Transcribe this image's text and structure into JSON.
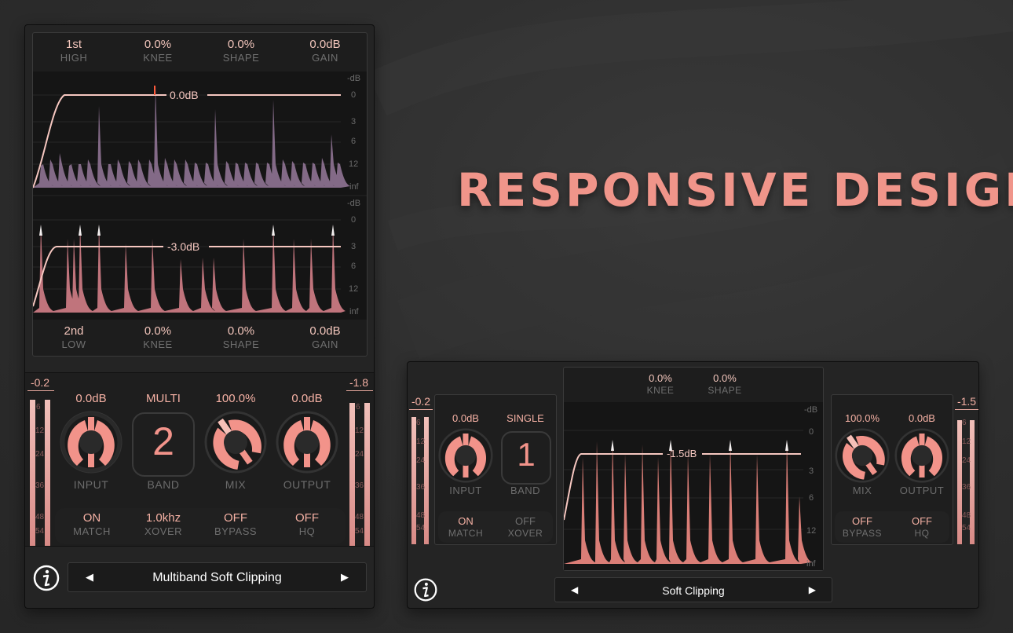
{
  "headline": "RESPONSIVE DESIGN",
  "colors": {
    "accent": "#f0958a",
    "knob": "#f2938a",
    "panel": "#242424",
    "wave_upper": "#8f7394",
    "wave_lower": "#c97982"
  },
  "icons": {
    "info": "info-icon",
    "prev": "left-arrow-icon",
    "next": "right-arrow-icon"
  },
  "large": {
    "top_params": [
      {
        "value": "1st",
        "label": "HIGH"
      },
      {
        "value": "0.0%",
        "label": "KNEE"
      },
      {
        "value": "0.0%",
        "label": "SHAPE"
      },
      {
        "value": "0.0dB",
        "label": "GAIN"
      }
    ],
    "upper_graph": {
      "threshold": "0.0dB",
      "scale": [
        "-dB",
        "0",
        "3",
        "6",
        "12",
        "inf"
      ]
    },
    "lower_graph": {
      "threshold": "-3.0dB",
      "scale": [
        "-dB",
        "0",
        "3",
        "6",
        "12",
        "inf"
      ]
    },
    "bottom_params": [
      {
        "value": "2nd",
        "label": "LOW"
      },
      {
        "value": "0.0%",
        "label": "KNEE"
      },
      {
        "value": "0.0%",
        "label": "SHAPE"
      },
      {
        "value": "0.0dB",
        "label": "GAIN"
      }
    ],
    "meter_left": "-0.2",
    "meter_right": "-1.8",
    "meter_scale": [
      "6",
      "12",
      "24",
      "36",
      "48",
      "54"
    ],
    "knobs": [
      {
        "value": "0.0dB",
        "label": "INPUT"
      },
      {
        "value": "MULTI",
        "label": "BAND",
        "display": "2"
      },
      {
        "value": "100.0%",
        "label": "MIX"
      },
      {
        "value": "0.0dB",
        "label": "OUTPUT"
      }
    ],
    "switches": [
      {
        "value": "ON",
        "label": "MATCH"
      },
      {
        "value": "1.0khz",
        "label": "XOVER"
      },
      {
        "value": "OFF",
        "label": "BYPASS"
      },
      {
        "value": "OFF",
        "label": "HQ"
      }
    ],
    "preset": "Multiband Soft Clipping"
  },
  "small": {
    "top_params": [
      {
        "value": "0.0%",
        "label": "KNEE"
      },
      {
        "value": "0.0%",
        "label": "SHAPE"
      }
    ],
    "graph": {
      "threshold": "-1.5dB",
      "scale": [
        "-dB",
        "0",
        "3",
        "6",
        "12",
        "inf"
      ]
    },
    "meter_left": "-0.2",
    "meter_right": "-1.5",
    "meter_scale": [
      "6",
      "12",
      "24",
      "36",
      "48",
      "54"
    ],
    "left_knobs": [
      {
        "value": "0.0dB",
        "label": "INPUT"
      },
      {
        "value": "SINGLE",
        "label": "BAND",
        "display": "1"
      }
    ],
    "left_switches": [
      {
        "value": "ON",
        "label": "MATCH"
      },
      {
        "value": "OFF",
        "label": "XOVER"
      }
    ],
    "right_knobs": [
      {
        "value": "100.0%",
        "label": "MIX"
      },
      {
        "value": "0.0dB",
        "label": "OUTPUT"
      }
    ],
    "right_switches": [
      {
        "value": "OFF",
        "label": "BYPASS"
      },
      {
        "value": "OFF",
        "label": "HQ"
      }
    ],
    "preset": "Soft Clipping"
  }
}
